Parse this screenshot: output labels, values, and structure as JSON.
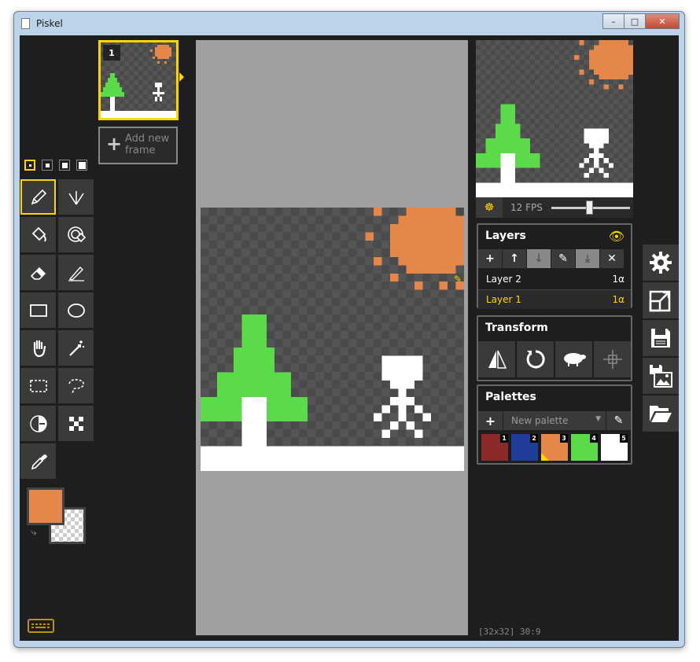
{
  "window": {
    "title": "Piskel",
    "minimize": "–",
    "maximize": "□",
    "close": "✕"
  },
  "frames": {
    "items": [
      {
        "number": "1"
      }
    ],
    "add_label": "Add new frame",
    "add_icon": "plus-icon"
  },
  "pen_sizes": {
    "count": 4,
    "selected_index": 0
  },
  "tools": [
    {
      "name": "pen-tool",
      "icon": "pencil-icon",
      "selected": true
    },
    {
      "name": "vertical-mirror-pen-tool",
      "icon": "mirror-pen-icon"
    },
    {
      "name": "paint-bucket-tool",
      "icon": "bucket-icon"
    },
    {
      "name": "paint-all-same-color-tool",
      "icon": "bucket-all-icon"
    },
    {
      "name": "eraser-tool",
      "icon": "eraser-icon"
    },
    {
      "name": "stroke-tool",
      "icon": "stroke-icon"
    },
    {
      "name": "rectangle-tool",
      "icon": "rectangle-icon"
    },
    {
      "name": "circle-tool",
      "icon": "ellipse-icon"
    },
    {
      "name": "move-tool",
      "icon": "hand-icon"
    },
    {
      "name": "magic-wand-tool",
      "icon": "magic-wand-icon"
    },
    {
      "name": "rectangle-select-tool",
      "icon": "rect-select-icon"
    },
    {
      "name": "lasso-select-tool",
      "icon": "lasso-icon"
    },
    {
      "name": "lighten-tool",
      "icon": "lighten-icon"
    },
    {
      "name": "dithering-tool",
      "icon": "checker-icon"
    },
    {
      "name": "color-picker-tool",
      "icon": "eyedropper-icon"
    }
  ],
  "colors": {
    "primary": "#e5874a",
    "secondary": "transparent",
    "swap_icon": "swap-icon"
  },
  "palette_colors": {
    "green": "#5bdb4a",
    "white": "#ffffff",
    "orange": "#e5874a"
  },
  "preview": {
    "fps_label": "12 FPS",
    "fps": 12,
    "onion_icon": "onion-skin-icon"
  },
  "layers": {
    "title": "Layers",
    "buttons": [
      "+",
      "↑",
      "↓",
      "✎",
      "⤓",
      "✕"
    ],
    "items": [
      {
        "name": "Layer 2",
        "alpha": "1α",
        "selected": false
      },
      {
        "name": "Layer 1",
        "alpha": "1α",
        "selected": true
      }
    ]
  },
  "transform": {
    "title": "Transform",
    "buttons": [
      "flip-icon",
      "rotate-icon",
      "sheep-icon",
      "center-icon"
    ]
  },
  "palettes": {
    "title": "Palettes",
    "selected": "New palette",
    "swatches": [
      {
        "num": "1",
        "color": "#8b2a2a"
      },
      {
        "num": "2",
        "color": "#1f3d99"
      },
      {
        "num": "3",
        "color": "#e5874a"
      },
      {
        "num": "4",
        "color": "#5bdb4a"
      },
      {
        "num": "5",
        "color": "#ffffff"
      }
    ]
  },
  "side_buttons": [
    "gear-icon",
    "resize-icon",
    "save-icon",
    "export-image-icon",
    "open-folder-icon"
  ],
  "status": {
    "text": "[32x32] 30:9"
  }
}
